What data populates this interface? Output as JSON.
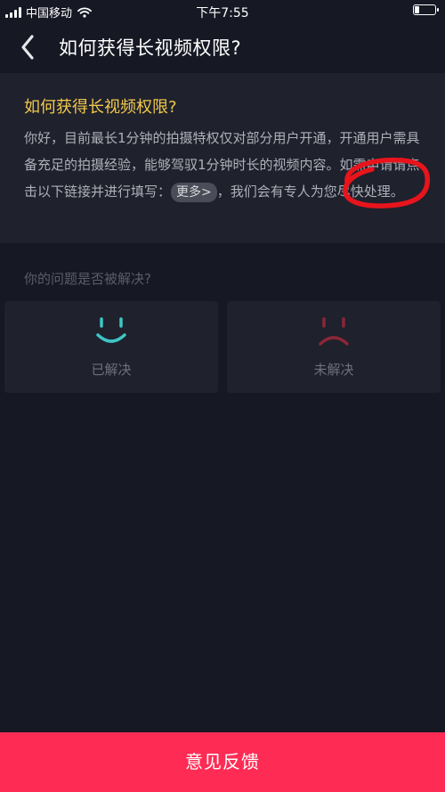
{
  "status_bar": {
    "carrier": "中国移动",
    "time": "下午7:55"
  },
  "nav": {
    "title": "如何获得长视频权限?",
    "back_icon": "chevron-left-icon"
  },
  "answer": {
    "title": "如何获得长视频权限?",
    "body_before_link": "你好，目前最长1分钟的拍摄特权仅对部分用户开通，开通用户需具备充足的拍摄经验，能够驾驭1分钟时长的视频内容。如需申请请点击以下链接并进行填写：",
    "more_link": "更多>",
    "body_after_link": "，我们会有专人为您尽快处理。"
  },
  "feedback": {
    "question": "你的问题是否被解决?",
    "solved_label": "已解决",
    "unsolved_label": "未解决"
  },
  "bottom_button": {
    "label": "意见反馈"
  },
  "colors": {
    "background": "#161823",
    "card": "#1f212d",
    "title_yellow": "#f2c94c",
    "smile_teal": "#3ec6c6",
    "frown_red": "#8b2636",
    "button_red": "#fe2c55",
    "annotation_red": "#e8141c"
  }
}
